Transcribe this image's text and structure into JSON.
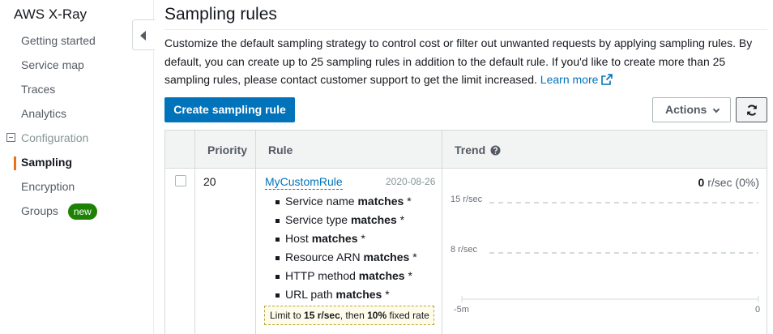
{
  "sidebar": {
    "title": "AWS X-Ray",
    "items": [
      {
        "label": "Getting started"
      },
      {
        "label": "Service map"
      },
      {
        "label": "Traces"
      },
      {
        "label": "Analytics"
      }
    ],
    "section": {
      "label": "Configuration",
      "items": [
        {
          "label": "Sampling",
          "active": true
        },
        {
          "label": "Encryption"
        },
        {
          "label": "Groups",
          "badge": "new"
        }
      ]
    }
  },
  "page": {
    "title": "Sampling rules",
    "description": "Customize the default sampling strategy to control cost or filter out unwanted requests by applying sampling rules. By default, you can create up to 25 sampling rules in addition to the default rule. If you'd like to create more than 25 sampling rules, please contact customer support to get the limit increased.",
    "learn_more": "Learn more"
  },
  "toolbar": {
    "create_label": "Create sampling rule",
    "actions_label": "Actions",
    "refresh_icon": "refresh-icon"
  },
  "table": {
    "headers": {
      "priority": "Priority",
      "rule": "Rule",
      "trend": "Trend"
    },
    "rows": [
      {
        "priority": "20",
        "name": "MyCustomRule",
        "date": "2020-08-26",
        "conditions": [
          {
            "field": "Service name",
            "op": "matches",
            "value": "*"
          },
          {
            "field": "Service type",
            "op": "matches",
            "value": "*"
          },
          {
            "field": "Host",
            "op": "matches",
            "value": "*"
          },
          {
            "field": "Resource ARN",
            "op": "matches",
            "value": "*"
          },
          {
            "field": "HTTP method",
            "op": "matches",
            "value": "*"
          },
          {
            "field": "URL path",
            "op": "matches",
            "value": "*"
          }
        ],
        "limit": {
          "prefix": "Limit to",
          "rate": "15 r/sec",
          "mid": ", then",
          "fixed": "10%",
          "suffix": "fixed rate"
        },
        "trend": {
          "rate_value": "0",
          "rate_text": "r/sec (0%)",
          "y_labels": [
            "15 r/sec",
            "8 r/sec"
          ],
          "x_labels": [
            "-5m",
            "0"
          ]
        }
      }
    ]
  },
  "colors": {
    "accent": "#ec7211",
    "primary": "#0073bb",
    "badge": "#1d8102"
  }
}
